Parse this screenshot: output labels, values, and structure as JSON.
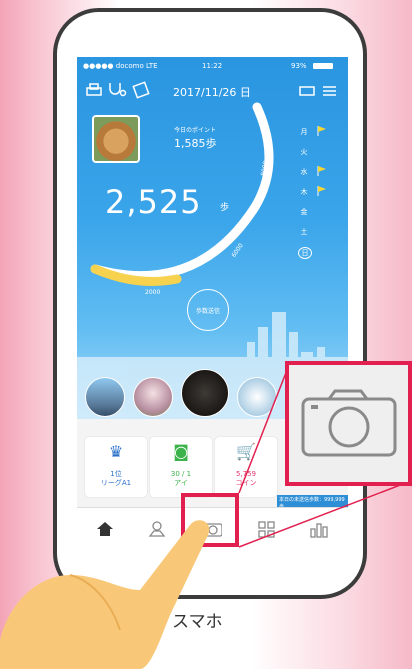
{
  "status": {
    "carrier": "●●●●● docomo LTE",
    "time": "11:22",
    "battery": "93%"
  },
  "header": {
    "date": "2017/11/26 日"
  },
  "today": {
    "label": "今日のポイント",
    "points": "1,585歩"
  },
  "total": {
    "steps": "2,525",
    "unit": "歩"
  },
  "arc_labels": {
    "a": "2000",
    "b": "6000",
    "c": "8000"
  },
  "send_button": "歩数送信",
  "weekdays": [
    "月",
    "火",
    "水",
    "木",
    "金",
    "土",
    "日"
  ],
  "cards": [
    {
      "line1": "1位",
      "line2": "リーグA1"
    },
    {
      "line1": "30 / 1",
      "line2": "アイ"
    },
    {
      "line1": "5,759",
      "line2": "コイン"
    }
  ],
  "remaining": "本日の未送信歩数：999,999歩",
  "caption": "スマホ",
  "colors": {
    "sky": "#2a95e0",
    "accent": "#e2204f",
    "arc": "#f6d24e",
    "flag": "#f5d535"
  },
  "icons": [
    "home-icon",
    "map-pin-icon",
    "camera-icon",
    "grid-icon",
    "bar-chart-icon"
  ]
}
